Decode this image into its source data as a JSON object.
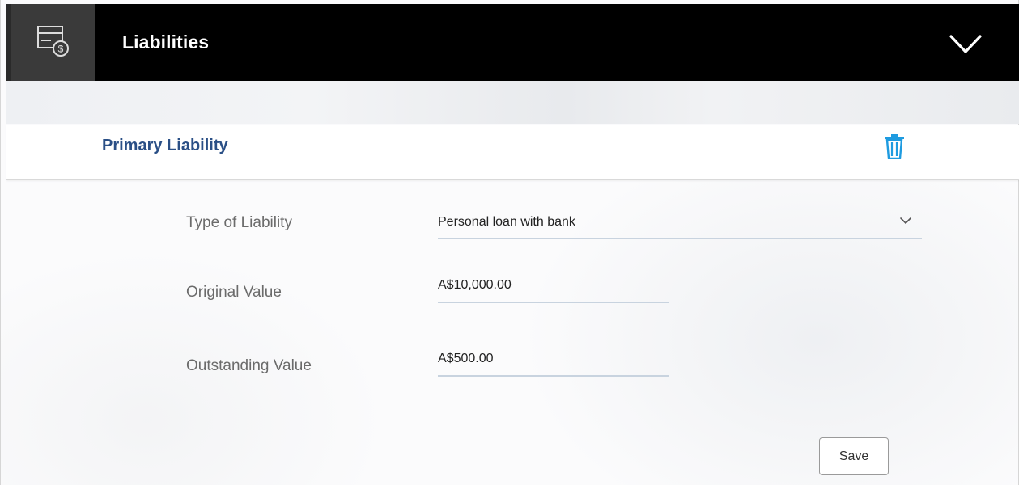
{
  "header": {
    "title": "Liabilities",
    "icon": "bill-dollar-icon",
    "toggle_icon": "chevron-down-icon"
  },
  "section": {
    "title": "Primary Liability",
    "delete_icon": "trash-icon",
    "accent_color": "#1e9be0"
  },
  "form": {
    "type_of_liability": {
      "label": "Type of Liability",
      "value": "Personal loan with bank"
    },
    "original_value": {
      "label": "Original Value",
      "value": "A$10,000.00"
    },
    "outstanding_value": {
      "label": "Outstanding Value",
      "value": "A$500.00"
    }
  },
  "actions": {
    "save_label": "Save"
  },
  "colors": {
    "header_bg": "#000000",
    "title_blue": "#2a4f86"
  }
}
